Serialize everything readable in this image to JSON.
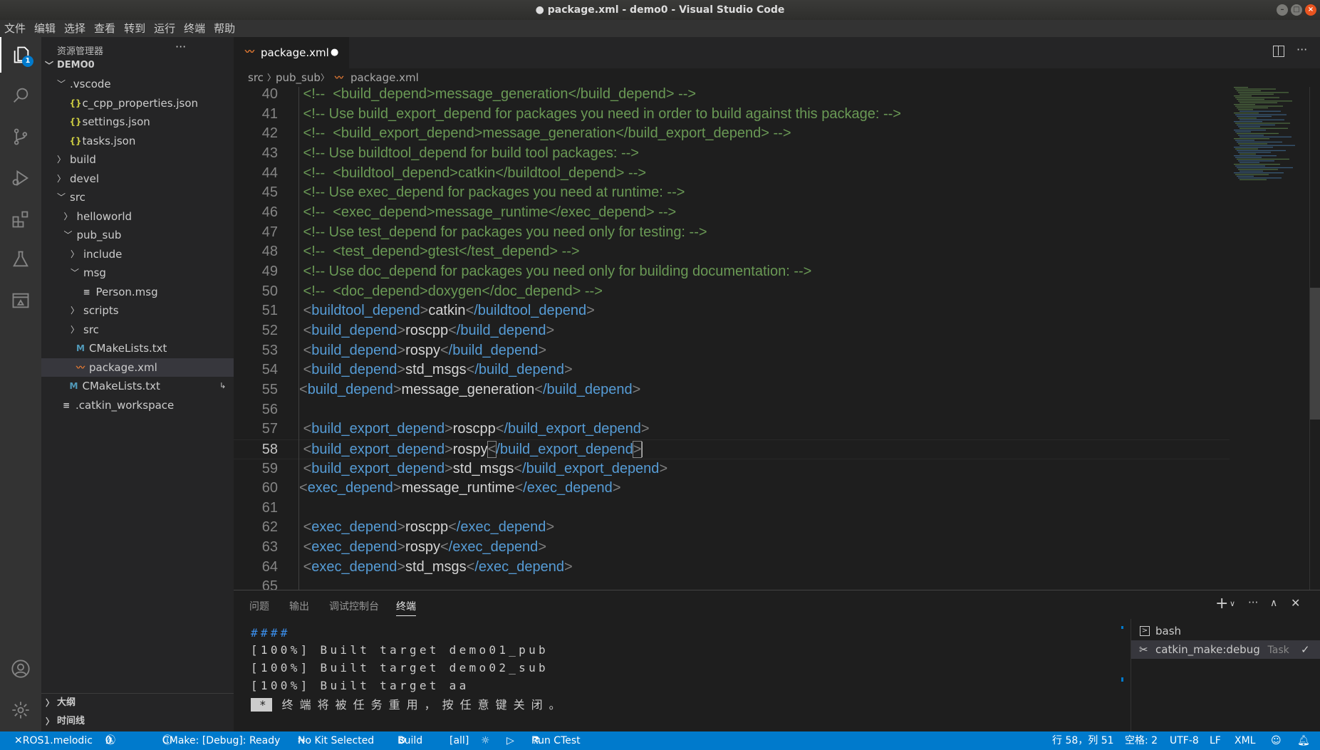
{
  "window": {
    "title": "package.xml - demo0 - Visual Studio Code",
    "modified_dot": "●"
  },
  "menu": [
    "文件",
    "编辑",
    "选择",
    "查看",
    "转到",
    "运行",
    "终端",
    "帮助"
  ],
  "activity": {
    "explorer_badge": "1"
  },
  "sidebar": {
    "title": "资源管理器",
    "more": "···",
    "root": "DEMO0",
    "items": [
      {
        "label": ".vscode",
        "level": 1,
        "kind": "folder",
        "open": true
      },
      {
        "label": "c_cpp_properties.json",
        "level": 2,
        "kind": "json"
      },
      {
        "label": "settings.json",
        "level": 2,
        "kind": "json"
      },
      {
        "label": "tasks.json",
        "level": 2,
        "kind": "json"
      },
      {
        "label": "build",
        "level": 1,
        "kind": "folder",
        "open": false
      },
      {
        "label": "devel",
        "level": 1,
        "kind": "folder",
        "open": false
      },
      {
        "label": "src",
        "level": 1,
        "kind": "folder",
        "open": true
      },
      {
        "label": "helloworld",
        "level": 2,
        "kind": "folder",
        "open": false
      },
      {
        "label": "pub_sub",
        "level": 2,
        "kind": "folder",
        "open": true
      },
      {
        "label": "include",
        "level": 3,
        "kind": "folder",
        "open": false
      },
      {
        "label": "msg",
        "level": 3,
        "kind": "folder",
        "open": true
      },
      {
        "label": "Person.msg",
        "level": 4,
        "kind": "text"
      },
      {
        "label": "scripts",
        "level": 3,
        "kind": "folder",
        "open": false
      },
      {
        "label": "src",
        "level": 3,
        "kind": "folder",
        "open": false
      },
      {
        "label": "CMakeLists.txt",
        "level": 3,
        "kind": "cmake"
      },
      {
        "label": "package.xml",
        "level": 3,
        "kind": "xml",
        "selected": true
      },
      {
        "label": "CMakeLists.txt",
        "level": 2,
        "kind": "cmake",
        "symlink": true
      },
      {
        "label": ".catkin_workspace",
        "level": 1,
        "kind": "text"
      }
    ],
    "sections": [
      "大纲",
      "时间线"
    ]
  },
  "tab": {
    "label": "package.xml",
    "dirty": "●"
  },
  "breadcrumb": [
    "src",
    "pub_sub",
    "package.xml"
  ],
  "editor": {
    "current_line": 58,
    "lines": [
      {
        "n": 40,
        "comment": " <!--  <build_depend>message_generation</build_depend> -->"
      },
      {
        "n": 41,
        "comment": " <!-- Use build_export_depend for packages you need in order to build against this package: -->"
      },
      {
        "n": 42,
        "comment": " <!--  <build_export_depend>message_generation</build_export_depend> -->"
      },
      {
        "n": 43,
        "comment": " <!-- Use buildtool_depend for build tool packages: -->"
      },
      {
        "n": 44,
        "comment": " <!--  <buildtool_depend>catkin</buildtool_depend> -->"
      },
      {
        "n": 45,
        "comment": " <!-- Use exec_depend for packages you need at runtime: -->"
      },
      {
        "n": 46,
        "comment": " <!--  <exec_depend>message_runtime</exec_depend> -->"
      },
      {
        "n": 47,
        "comment": " <!-- Use test_depend for packages you need only for testing: -->"
      },
      {
        "n": 48,
        "comment": " <!--  <test_depend>gtest</test_depend> -->"
      },
      {
        "n": 49,
        "comment": " <!-- Use doc_depend for packages you need only for building documentation: -->"
      },
      {
        "n": 50,
        "comment": " <!--  <doc_depend>doxygen</doc_depend> -->"
      },
      {
        "n": 51,
        "lead": " ",
        "tag": "buildtool_depend",
        "value": "catkin"
      },
      {
        "n": 52,
        "lead": " ",
        "tag": "build_depend",
        "value": "roscpp"
      },
      {
        "n": 53,
        "lead": " ",
        "tag": "build_depend",
        "value": "rospy"
      },
      {
        "n": 54,
        "lead": " ",
        "tag": "build_depend",
        "value": "std_msgs"
      },
      {
        "n": 55,
        "lead": "",
        "tag": "build_depend",
        "value": "message_generation"
      },
      {
        "n": 56
      },
      {
        "n": 57,
        "lead": " ",
        "tag": "build_export_depend",
        "value": "roscpp"
      },
      {
        "n": 58,
        "lead": " ",
        "tag": "build_export_depend",
        "value": "rospy"
      },
      {
        "n": 59,
        "lead": " ",
        "tag": "build_export_depend",
        "value": "std_msgs"
      },
      {
        "n": 60,
        "lead": "",
        "tag": "exec_depend",
        "value": "message_runtime"
      },
      {
        "n": 61
      },
      {
        "n": 62,
        "lead": " ",
        "tag": "exec_depend",
        "value": "roscpp"
      },
      {
        "n": 63,
        "lead": " ",
        "tag": "exec_depend",
        "value": "rospy"
      },
      {
        "n": 64,
        "lead": " ",
        "tag": "exec_depend",
        "value": "std_msgs"
      },
      {
        "n": 65
      }
    ]
  },
  "panel": {
    "tabs": [
      "问题",
      "输出",
      "调试控制台",
      "终端"
    ],
    "active_tab": "终端",
    "terminal_lines": [
      "####",
      "[100%] Built target demo01_pub",
      "[100%] Built target demo02_sub",
      "[100%] Built target aa"
    ],
    "terminal_cursor": "*",
    "terminal_msg": "终端将被任务重用，按任意键关闭。",
    "terminals": [
      {
        "label": "bash"
      },
      {
        "label": "catkin_make:debug",
        "tag": "Task",
        "check": "✓"
      }
    ]
  },
  "status": {
    "remote": "ROS1.melodic",
    "errors": "0",
    "warnings": "0",
    "cmake": "CMake: [Debug]: Ready",
    "kit": "No Kit Selected",
    "build": "Build",
    "target": "[all]",
    "ctest": "Run CTest",
    "position": "行 58，列 51",
    "spaces": "空格: 2",
    "encoding": "UTF-8",
    "eol": "LF",
    "language": "XML"
  },
  "colors": {
    "statusbar": "#007acc",
    "comment": "#6a9955",
    "tag": "#569cd6",
    "xml_icon": "#e37933",
    "badge": "#007acc"
  }
}
